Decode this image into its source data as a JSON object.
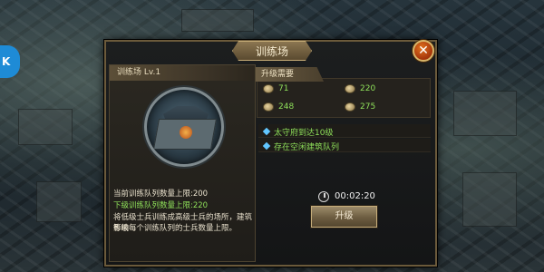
{
  "dialog": {
    "title": "训练场",
    "close_label": "✕"
  },
  "building": {
    "header": "训练场  Lv.1",
    "info_current": "当前训练队列数量上限:200",
    "info_next": "下级训练队列数量上限:220",
    "description_line1": "将低级士兵训练成高级士兵的场所，建筑等级",
    "description_line2": "影响每个训练队列的士兵数量上限。"
  },
  "requirements": {
    "header": "升级需要",
    "resources": [
      {
        "icon": "food-icon",
        "value": "71"
      },
      {
        "icon": "wood-icon",
        "value": "220"
      },
      {
        "icon": "iron-icon",
        "value": "248"
      },
      {
        "icon": "stone-icon",
        "value": "275"
      }
    ],
    "conditions": [
      {
        "icon": "diamond-icon",
        "text": "太守府到达10级"
      },
      {
        "icon": "diamond-icon",
        "text": "存在空闲建筑队列"
      }
    ],
    "timer": "00:02:20",
    "upgrade_label": "升级"
  },
  "side_tab": {
    "label": "K"
  },
  "colors": {
    "met_text": "#8fe05a",
    "panel_border": "#6b5a3b",
    "accent_blue": "#61c6ff"
  }
}
